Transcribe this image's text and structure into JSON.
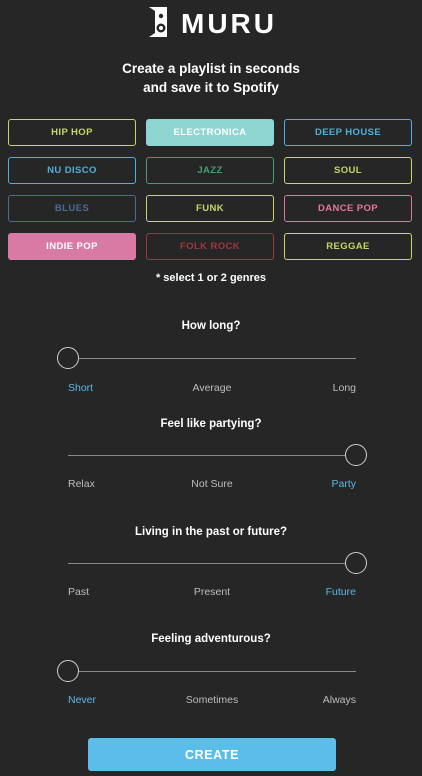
{
  "app": {
    "name": "MURU",
    "logo_icon": "speaker-icon"
  },
  "tagline": {
    "line1": "Create a playlist in seconds",
    "line2": "and save it to Spotify"
  },
  "genres": [
    {
      "label": "HIP HOP",
      "color": "#c7d56a",
      "selected": false
    },
    {
      "label": "ELECTRONICA",
      "color": "#8fd5d2",
      "selected": true
    },
    {
      "label": "DEEP HOUSE",
      "color": "#4fb0db",
      "selected": false
    },
    {
      "label": "NU DISCO",
      "color": "#4fb0db",
      "selected": false
    },
    {
      "label": "JAZZ",
      "color": "#4b9a72",
      "selected": false
    },
    {
      "label": "SOUL",
      "color": "#c7d56a",
      "selected": false
    },
    {
      "label": "BLUES",
      "color": "#4d6a94",
      "selected": false
    },
    {
      "label": "FUNK",
      "color": "#c7d56a",
      "selected": false
    },
    {
      "label": "DANCE POP",
      "color": "#e3769e",
      "selected": false
    },
    {
      "label": "INDIE POP",
      "color": "#d97aa4",
      "selected": true
    },
    {
      "label": "FOLK ROCK",
      "color": "#9c3842",
      "selected": false
    },
    {
      "label": "REGGAE",
      "color": "#c7d56a",
      "selected": false
    }
  ],
  "genre_hint": "* select 1 or 2 genres",
  "questions": [
    {
      "title": "How long?",
      "options": [
        "Short",
        "Average",
        "Long"
      ],
      "selected_index": 0
    },
    {
      "title": "Feel like partying?",
      "options": [
        "Relax",
        "Not Sure",
        "Party"
      ],
      "selected_index": 2
    },
    {
      "title": "Living in the past or future?",
      "options": [
        "Past",
        "Present",
        "Future"
      ],
      "selected_index": 2
    },
    {
      "title": "Feeling adventurous?",
      "options": [
        "Never",
        "Sometimes",
        "Always"
      ],
      "selected_index": 0
    }
  ],
  "create_button": {
    "label": "CREATE"
  },
  "colors": {
    "background": "#262626",
    "accent": "#5bbde9",
    "active_label": "#5ab8e6"
  }
}
